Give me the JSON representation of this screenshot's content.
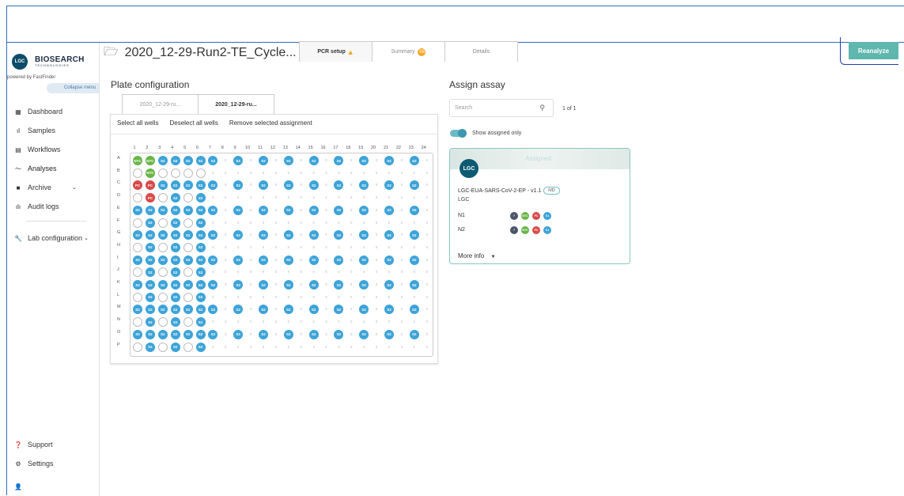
{
  "app": {
    "logo_short": "LGC",
    "brand_line1": "BIOSEARCH",
    "brand_line2": "TECHNOLOGIES",
    "powered_by": "powered by FastFinder",
    "collapse_menu": "Collapse menu"
  },
  "sidebar": {
    "items": [
      {
        "label": "Dashboard",
        "icon": "dashboard-icon",
        "glyph": "▦"
      },
      {
        "label": "Samples",
        "icon": "samples-icon",
        "glyph": "ıl"
      },
      {
        "label": "Workflows",
        "icon": "workflows-icon",
        "glyph": "▤"
      },
      {
        "label": "Analyses",
        "icon": "analyses-icon",
        "glyph": "〜"
      },
      {
        "label": "Archive",
        "icon": "archive-icon",
        "glyph": "■"
      },
      {
        "label": "Audit logs",
        "icon": "audit-icon",
        "glyph": "ılı"
      }
    ],
    "lab_config": "Lab configuration",
    "support": "Support",
    "settings": "Settings"
  },
  "header": {
    "title": "2020_12-29-Run2-TE_Cycle...",
    "tabs": [
      {
        "label": "PCR setup"
      },
      {
        "label": "Summary",
        "badge": "56"
      },
      {
        "label": "Details"
      }
    ],
    "reanalyze": "Reanalyze"
  },
  "plate": {
    "heading": "Plate configuration",
    "tabs": [
      "2020_12-29-ru...",
      "2020_12-29-ru..."
    ],
    "actions": [
      "Select all wells",
      "Deselect all wells",
      "Remove selected assignment"
    ],
    "columns": [
      "1",
      "2",
      "3",
      "4",
      "5",
      "6",
      "7",
      "8",
      "9",
      "10",
      "11",
      "12",
      "13",
      "14",
      "15",
      "16",
      "17",
      "18",
      "19",
      "20",
      "21",
      "22",
      "23",
      "24"
    ],
    "rows": [
      "A",
      "B",
      "C",
      "D",
      "E",
      "F",
      "G",
      "H",
      "I",
      "J",
      "K",
      "L",
      "M",
      "N",
      "O",
      "P"
    ],
    "wells": [
      [
        "NTC",
        "NTC",
        "S2",
        "S2",
        "S2",
        "S2",
        "S2",
        "x",
        "S2",
        "x",
        "S2",
        "x",
        "S2",
        "x",
        "S2",
        "x",
        "S2",
        "x",
        "S2",
        "x",
        "S2",
        "x",
        "S2",
        "x"
      ],
      [
        "o",
        "NTC",
        "o",
        "o",
        "o",
        "o",
        "x",
        "x",
        "x",
        "x",
        "x",
        "x",
        "x",
        "x",
        "x",
        "x",
        "x",
        "x",
        "x",
        "x",
        "x",
        "x",
        "x",
        "x"
      ],
      [
        "PC",
        "PC",
        "S2",
        "S2",
        "S2",
        "S2",
        "S2",
        "x",
        "S2",
        "x",
        "S2",
        "x",
        "S2",
        "x",
        "S2",
        "x",
        "S2",
        "x",
        "S2",
        "x",
        "S2",
        "x",
        "S2",
        "x"
      ],
      [
        "o",
        "PC",
        "o",
        "S2",
        "o",
        "S2",
        "x",
        "x",
        "x",
        "x",
        "x",
        "x",
        "x",
        "x",
        "x",
        "x",
        "x",
        "x",
        "x",
        "x",
        "x",
        "x",
        "x",
        "x"
      ],
      [
        "S2",
        "S2",
        "S2",
        "S2",
        "S2",
        "S2",
        "S2",
        "x",
        "S2",
        "x",
        "S2",
        "x",
        "S2",
        "x",
        "S2",
        "x",
        "S2",
        "x",
        "S2",
        "x",
        "S2",
        "x",
        "S2",
        "x"
      ],
      [
        "o",
        "S2",
        "o",
        "S2",
        "o",
        "S2",
        "x",
        "x",
        "x",
        "x",
        "x",
        "x",
        "x",
        "x",
        "x",
        "x",
        "x",
        "x",
        "x",
        "x",
        "x",
        "x",
        "x",
        "x"
      ],
      [
        "S2",
        "S2",
        "S2",
        "S2",
        "S2",
        "S2",
        "S2",
        "x",
        "S2",
        "x",
        "S2",
        "x",
        "S2",
        "x",
        "S2",
        "x",
        "S2",
        "x",
        "S2",
        "x",
        "S2",
        "x",
        "S2",
        "x"
      ],
      [
        "o",
        "S2",
        "o",
        "S2",
        "o",
        "S2",
        "x",
        "x",
        "x",
        "x",
        "x",
        "x",
        "x",
        "x",
        "x",
        "x",
        "x",
        "x",
        "x",
        "x",
        "x",
        "x",
        "x",
        "x"
      ],
      [
        "S2",
        "S2",
        "S2",
        "S2",
        "S2",
        "S2",
        "S2",
        "x",
        "S2",
        "x",
        "S2",
        "x",
        "S2",
        "x",
        "S2",
        "x",
        "S2",
        "x",
        "S2",
        "x",
        "S2",
        "x",
        "S2",
        "x"
      ],
      [
        "o",
        "S2",
        "o",
        "S2",
        "o",
        "S2",
        "x",
        "x",
        "x",
        "x",
        "x",
        "x",
        "x",
        "x",
        "x",
        "x",
        "x",
        "x",
        "x",
        "x",
        "x",
        "x",
        "x",
        "x"
      ],
      [
        "S2",
        "S2",
        "S2",
        "S2",
        "S2",
        "S2",
        "S2",
        "x",
        "S2",
        "x",
        "S2",
        "x",
        "S2",
        "x",
        "S2",
        "x",
        "S2",
        "x",
        "S2",
        "x",
        "S2",
        "x",
        "S2",
        "x"
      ],
      [
        "o",
        "S2",
        "o",
        "S2",
        "o",
        "S2",
        "x",
        "x",
        "x",
        "x",
        "x",
        "x",
        "x",
        "x",
        "x",
        "x",
        "x",
        "x",
        "x",
        "x",
        "x",
        "x",
        "x",
        "x"
      ],
      [
        "S2",
        "S2",
        "S2",
        "S2",
        "S2",
        "S2",
        "S2",
        "x",
        "S2",
        "x",
        "S2",
        "x",
        "S2",
        "x",
        "S2",
        "x",
        "S2",
        "x",
        "S2",
        "x",
        "S2",
        "x",
        "S2",
        "x"
      ],
      [
        "o",
        "S2",
        "o",
        "S2",
        "o",
        "S2",
        "x",
        "x",
        "x",
        "x",
        "x",
        "x",
        "x",
        "x",
        "x",
        "x",
        "x",
        "x",
        "x",
        "x",
        "x",
        "x",
        "x",
        "x"
      ],
      [
        "S2",
        "S2",
        "S2",
        "S2",
        "S2",
        "S2",
        "S2",
        "x",
        "S2",
        "x",
        "S2",
        "x",
        "S2",
        "x",
        "S2",
        "x",
        "S2",
        "x",
        "S2",
        "x",
        "S2",
        "x",
        "S2",
        "x"
      ],
      [
        "o",
        "S2",
        "o",
        "S2",
        "o",
        "S2",
        "x",
        "x",
        "x",
        "x",
        "x",
        "x",
        "x",
        "x",
        "x",
        "x",
        "x",
        "x",
        "x",
        "x",
        "x",
        "x",
        "x",
        "x"
      ]
    ]
  },
  "assay": {
    "heading": "Assign assay",
    "search_placeholder": "Search",
    "paging": "1  of 1",
    "toggle_label": "Show assigned only",
    "card": {
      "status": "Assigned",
      "logo": "LGC",
      "name": "LGC-EUA-SARS-CoV-2-EP - v1.1",
      "badge": "IVD",
      "vendor": "LGC",
      "targets": [
        {
          "name": "N1",
          "chips": [
            "?",
            "NTC",
            "PC",
            "S1"
          ]
        },
        {
          "name": "N2",
          "chips": [
            "?",
            "NTC",
            "PC",
            "S1"
          ]
        }
      ],
      "more_info": "More info"
    }
  },
  "colors": {
    "accent": "#5fb7ae",
    "sample": "#3da3d8",
    "ntc": "#69b548",
    "pc": "#d94a4a",
    "warning": "#f5a623"
  }
}
